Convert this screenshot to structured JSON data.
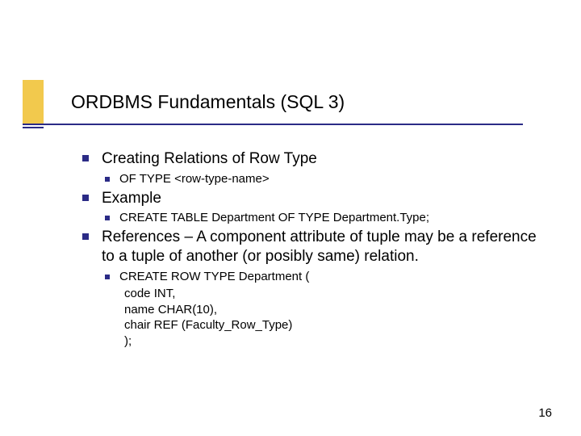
{
  "title": "ORDBMS Fundamentals (SQL 3)",
  "bullets": {
    "b0": {
      "text": "Creating Relations of Row Type"
    },
    "b0_0": {
      "text": "OF TYPE <row-type-name>"
    },
    "b1": {
      "text": "Example"
    },
    "b1_0": {
      "text": "CREATE TABLE Department OF TYPE Department.Type;"
    },
    "b2": {
      "text": "References – A component attribute of tuple may be a reference to a tuple of another (or posibly same) relation."
    },
    "b2_0": {
      "text": "CREATE ROW TYPE Department ("
    },
    "b2_0_lines": {
      "l0": "code INT,",
      "l1": "name CHAR(10),",
      "l2": "chair REF (Faculty_Row_Type)",
      "l3": ");"
    }
  },
  "page_number": "16"
}
